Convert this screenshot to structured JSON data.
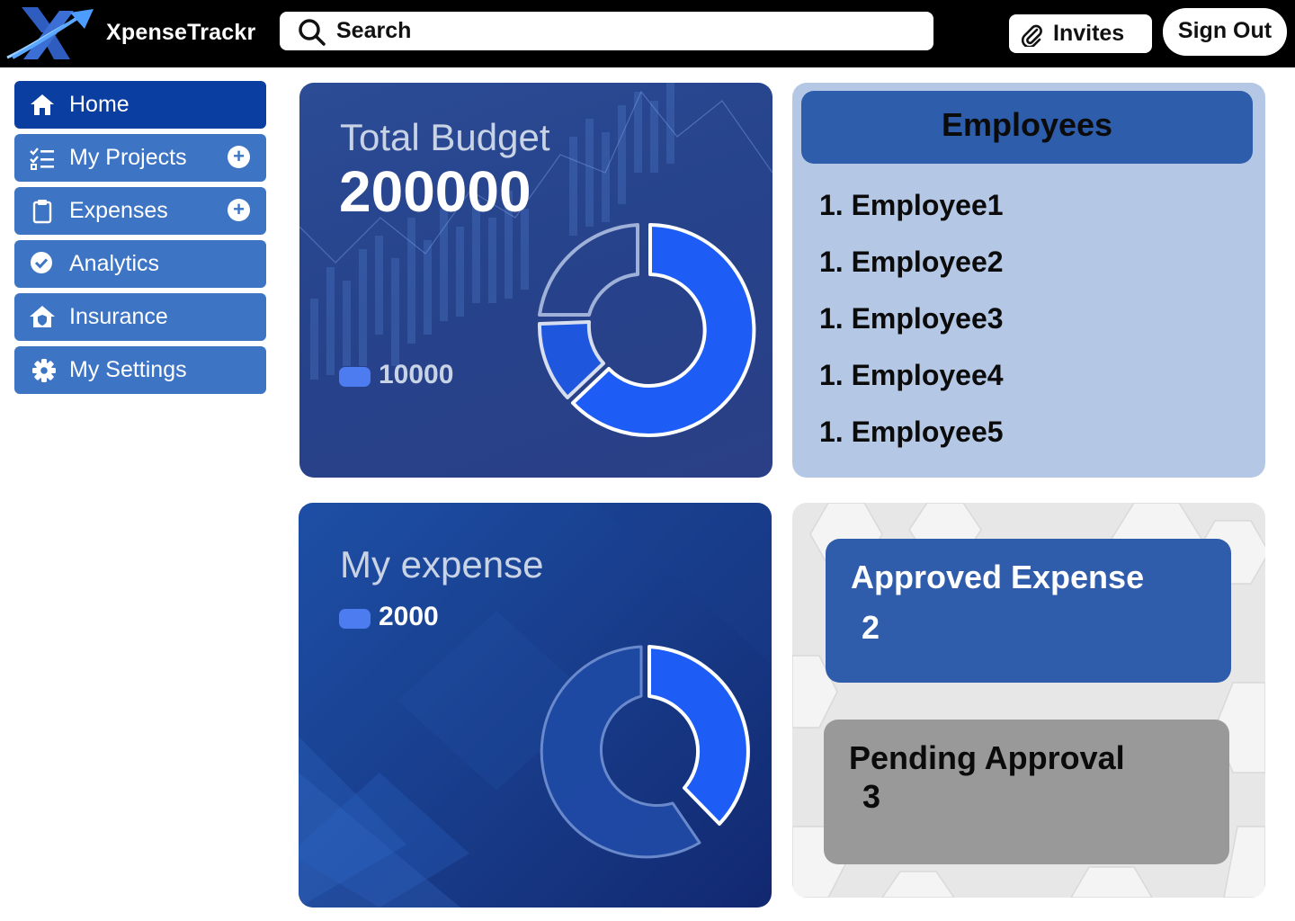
{
  "header": {
    "brand": "XpenseTrackr",
    "logo_icon": "x-arrow-logo-icon",
    "search_label": "Search",
    "search_icon": "search-icon",
    "invites_label": "Invites",
    "invites_icon": "paperclip-icon",
    "signout_label": "Sign Out"
  },
  "sidebar": {
    "items": [
      {
        "label": "Home",
        "icon": "home-icon",
        "active": true,
        "has_add": false
      },
      {
        "label": "My Projects",
        "icon": "checklist-icon",
        "active": false,
        "has_add": true
      },
      {
        "label": "Expenses",
        "icon": "clipboard-icon",
        "active": false,
        "has_add": true
      },
      {
        "label": "Analytics",
        "icon": "check-circle-icon",
        "active": false,
        "has_add": false
      },
      {
        "label": "Insurance",
        "icon": "house-shield-icon",
        "active": false,
        "has_add": false
      },
      {
        "label": "My Settings",
        "icon": "gear-icon",
        "active": false,
        "has_add": false
      }
    ],
    "add_symbol": "+"
  },
  "budget": {
    "title": "Total Budget",
    "value": "200000",
    "legend_value": "10000"
  },
  "expense": {
    "title": "My expense",
    "legend_value": "2000"
  },
  "employees": {
    "title": "Employees",
    "rows": [
      "1. Employee1",
      "1. Employee2",
      "1. Employee3",
      "1. Employee4",
      "1. Employee5"
    ]
  },
  "status": {
    "approved": {
      "title": "Approved Expense",
      "count": "2"
    },
    "pending": {
      "title": "Pending Approval",
      "count": "3"
    }
  },
  "colors": {
    "topbar": "#000000",
    "nav_default": "#3d74c4",
    "nav_active": "#0a3ea0",
    "donut_accent": "#1d5cf5",
    "employees_bg": "#b4c8e6",
    "approved_bg": "#2f5dab",
    "pending_bg": "#999999"
  }
}
